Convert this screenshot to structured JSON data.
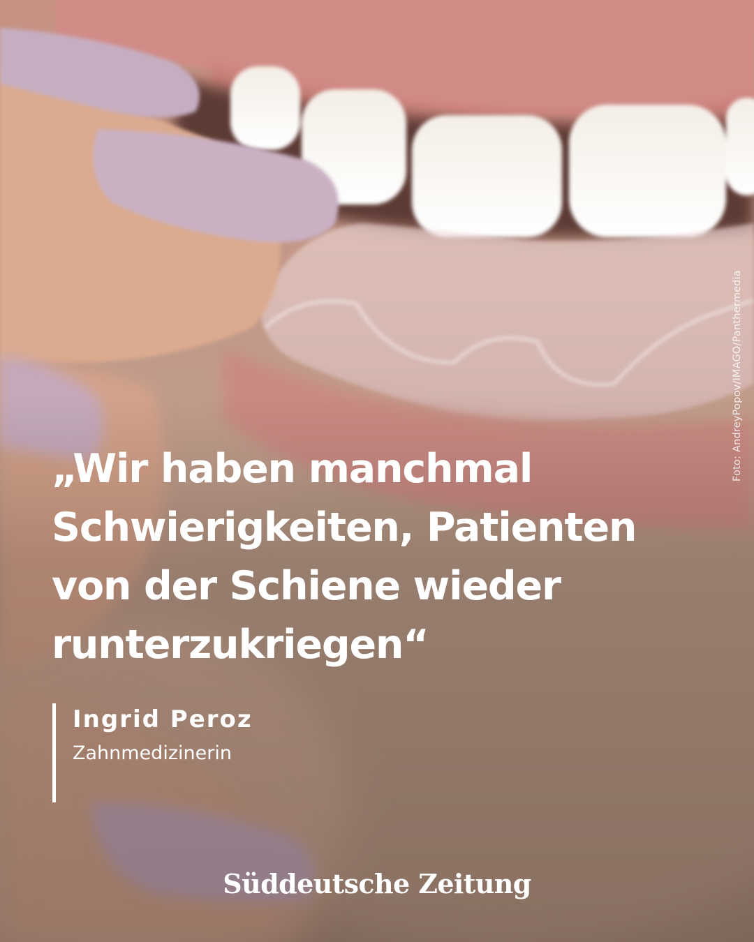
{
  "photo": {
    "subject": "close-up of a mouth with a hand holding a clear aligner splint",
    "credit": "Foto: AndreyPopov/IMAGO/Panthermedia"
  },
  "quote": {
    "lines": [
      "„Wir haben manchmal",
      "Schwierigkeiten, Patienten",
      "von der Schiene wieder",
      "runterzukriegen“"
    ]
  },
  "author": {
    "name": "Ingrid Peroz",
    "role": "Zahnmedizinerin"
  },
  "brand": {
    "logo_text": "Süddeutsche Zeitung"
  },
  "colors": {
    "text": "#ffffff",
    "lip": "#c97f7c",
    "nail": "#c2a8bc",
    "skin": "#d8ab92"
  }
}
